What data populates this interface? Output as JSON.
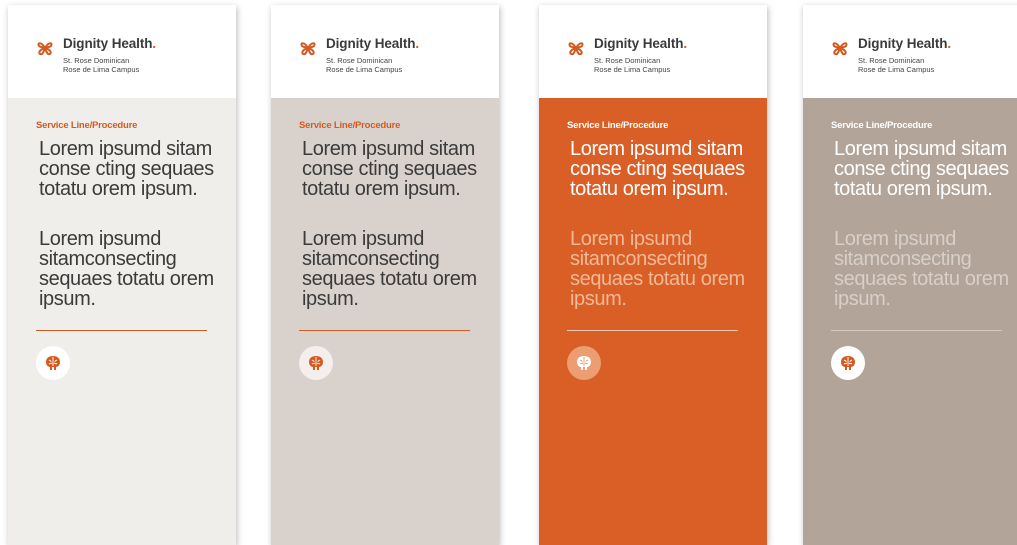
{
  "colors": {
    "accent": "#d35b22",
    "text_dark": "#3b3b3b",
    "panel_light": "#f0eeeb",
    "panel_beige": "#d9d2cc",
    "panel_orange": "#d95f27",
    "panel_taupe": "#b2a499"
  },
  "banners": [
    {
      "brand": "Dignity Health",
      "brand_dot": ".",
      "subtitle_line1": "St. Rose Dominican",
      "subtitle_line2": "Rose de Lima Campus",
      "service_line": "Service Line/Procedure",
      "paragraph1": "Lorem ipsumd sitam conse cting sequaes totatu orem ipsum.",
      "paragraph2": "Lorem ipsumd sitamconsecting sequaes totatu orem ipsum.",
      "icon": "brain-icon"
    },
    {
      "brand": "Dignity Health",
      "brand_dot": ".",
      "subtitle_line1": "St. Rose Dominican",
      "subtitle_line2": "Rose de Lima Campus",
      "service_line": "Service Line/Procedure",
      "paragraph1": "Lorem ipsumd sitam conse cting sequaes totatu orem ipsum.",
      "paragraph2": "Lorem ipsumd sitamconsecting sequaes totatu orem ipsum.",
      "icon": "brain-icon"
    },
    {
      "brand": "Dignity Health",
      "brand_dot": ".",
      "subtitle_line1": "St. Rose Dominican",
      "subtitle_line2": "Rose de Lima Campus",
      "service_line": "Service Line/Procedure",
      "paragraph1": "Lorem ipsumd sitam conse cting sequaes totatu orem ipsum.",
      "paragraph2": "Lorem ipsumd sitamconsecting sequaes totatu orem ipsum.",
      "icon": "brain-icon"
    },
    {
      "brand": "Dignity Health",
      "brand_dot": ".",
      "subtitle_line1": "St. Rose Dominican",
      "subtitle_line2": "Rose de Lima Campus",
      "service_line": "Service Line/Procedure",
      "paragraph1": "Lorem ipsumd sitam conse cting sequaes totatu orem ipsum.",
      "paragraph2": "Lorem ipsumd sitamconsecting sequaes totatu orem ipsum.",
      "icon": "brain-icon"
    }
  ]
}
